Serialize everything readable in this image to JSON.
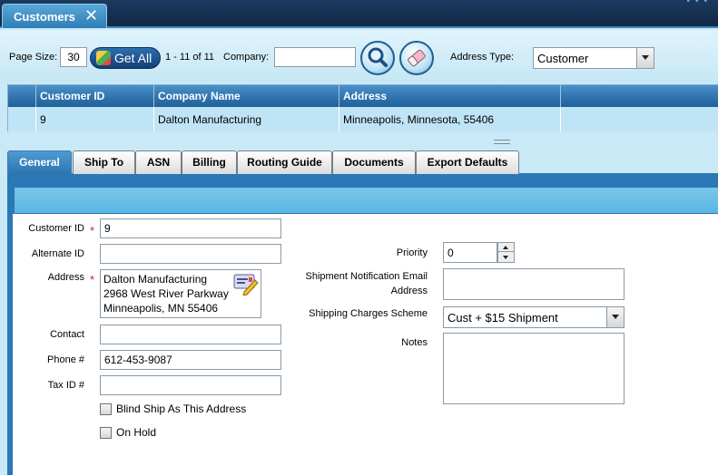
{
  "window": {
    "tab_title": "Customers"
  },
  "toolbar": {
    "page_size_label": "Page Size:",
    "page_size_value": "30",
    "get_all_label": "Get All",
    "record_range": "1 - 11 of 11",
    "company_label": "Company:",
    "company_value": "",
    "address_type_label": "Address Type:",
    "address_type_value": "Customer"
  },
  "grid": {
    "columns": [
      "Customer ID",
      "Company Name",
      "Address"
    ],
    "rows": [
      {
        "customer_id": "9",
        "company_name": "Dalton Manufacturing",
        "address": "Minneapolis, Minnesota, 55406"
      }
    ]
  },
  "tabs": [
    "General",
    "Ship To",
    "ASN",
    "Billing",
    "Routing Guide",
    "Documents",
    "Export Defaults"
  ],
  "form": {
    "customer_id_label": "Customer ID",
    "customer_id_value": "9",
    "alternate_id_label": "Alternate ID",
    "alternate_id_value": "",
    "address_label": "Address",
    "address_lines": [
      "Dalton Manufacturing",
      "2968 West River Parkway",
      "Minneapolis, MN 55406"
    ],
    "contact_label": "Contact",
    "contact_value": "",
    "phone_label": "Phone #",
    "phone_value": "612-453-9087",
    "tax_id_label": "Tax ID #",
    "tax_id_value": "",
    "blind_ship_label": "Blind Ship As This Address",
    "on_hold_label": "On Hold",
    "priority_label": "Priority",
    "priority_value": "0",
    "shipment_email_label_1": "Shipment Notification Email",
    "shipment_email_label_2": "Address",
    "shipment_email_value": "",
    "shipping_charges_label": "Shipping Charges Scheme",
    "shipping_charges_value": "Cust + $15 Shipment",
    "notes_label": "Notes",
    "notes_value": "",
    "required_marker": "*"
  }
}
